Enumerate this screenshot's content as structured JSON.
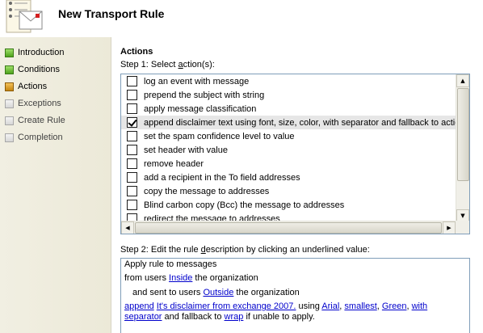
{
  "window": {
    "title": "New Transport Rule"
  },
  "nav": {
    "items": [
      {
        "label": "Introduction",
        "state": "done"
      },
      {
        "label": "Conditions",
        "state": "done"
      },
      {
        "label": "Actions",
        "state": "current"
      },
      {
        "label": "Exceptions",
        "state": "pending"
      },
      {
        "label": "Create Rule",
        "state": "pending"
      },
      {
        "label": "Completion",
        "state": "pending"
      }
    ]
  },
  "main": {
    "section_title": "Actions",
    "step1_prefix": "Step 1: Select ",
    "step1_underlined": "a",
    "step1_suffix": "ction(s):",
    "actions": [
      {
        "label": "log an event with message",
        "checked": false
      },
      {
        "label": "prepend the subject with string",
        "checked": false
      },
      {
        "label": "apply message classification",
        "checked": false
      },
      {
        "label": "append disclaimer text using font, size, color, with separator and fallback to action i",
        "checked": true
      },
      {
        "label": "set the spam confidence level to value",
        "checked": false
      },
      {
        "label": "set header with value",
        "checked": false
      },
      {
        "label": "remove header",
        "checked": false
      },
      {
        "label": "add a recipient in the To field addresses",
        "checked": false
      },
      {
        "label": "copy the message to addresses",
        "checked": false
      },
      {
        "label": "Blind carbon copy (Bcc) the message to addresses",
        "checked": false
      },
      {
        "label": "redirect the message to addresses",
        "checked": false
      }
    ],
    "step2_prefix": "Step 2: Edit the rule ",
    "step2_underlined": "d",
    "step2_suffix": "escription by clicking an underlined value:",
    "description": {
      "line1": "Apply rule to messages",
      "line2_a": "from users ",
      "line2_link": "Inside",
      "line2_b": " the organization",
      "line3_a": "and sent to users ",
      "line3_link": "Outside",
      "line3_b": " the organization",
      "line4_link1": "append",
      "line4_link2": "It's disclaimer from exchange 2007.",
      "line4_t1": " using ",
      "line4_link3": "Arial",
      "line4_link4": "smallest",
      "line4_link5": "Green",
      "line4_link6": "with",
      "line5_link1": "separator",
      "line5_t1": " and fallback to ",
      "line5_link2": "wrap",
      "line5_t2": " if unable to apply."
    }
  },
  "colors": {
    "border": "#7f9db9",
    "link": "#0000cc",
    "done": "#4fa21c",
    "current": "#c4840f"
  }
}
